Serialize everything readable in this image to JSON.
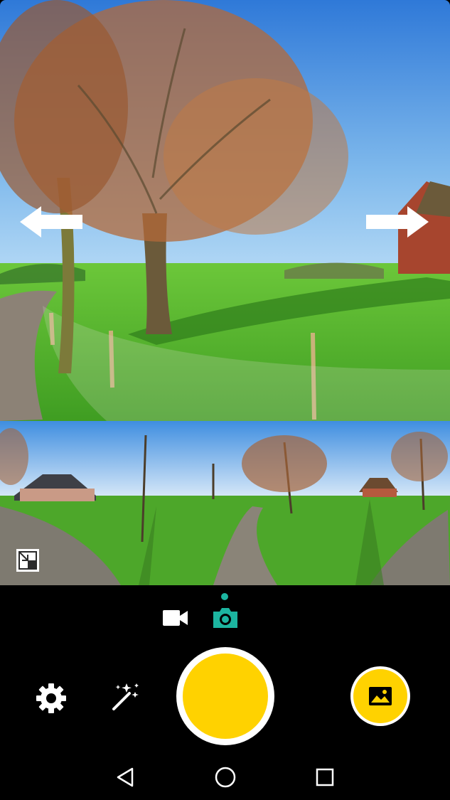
{
  "viewfinder": {
    "scene": "landscape-photo",
    "colors": {
      "sky_top": "#2f79d8",
      "sky_bottom": "#b9dcf6",
      "grass": "#55b82c",
      "grass_dark": "#2e8a1a",
      "foliage": "#b36a3a",
      "trunk": "#6b5a3a"
    }
  },
  "panorama_preview": {
    "colors": {
      "sky": "#3f8ee0",
      "horizon": "#e9f3fb",
      "ground": "#4da72a"
    }
  },
  "camera_modes": {
    "active": "photo",
    "items": [
      "video",
      "photo"
    ]
  },
  "accent_colors": {
    "active_mode": "#1cb5a0",
    "shutter": "#ffd200"
  },
  "icons": {
    "left_arrow": "arrow-left-icon",
    "right_arrow": "arrow-right-icon",
    "expand": "expand-icon",
    "video": "video-camera-icon",
    "photo": "camera-icon",
    "settings": "gear-icon",
    "effects": "magic-wand-icon",
    "gallery": "image-icon",
    "back": "back-triangle-icon",
    "home": "home-circle-icon",
    "recents": "recents-square-icon"
  }
}
